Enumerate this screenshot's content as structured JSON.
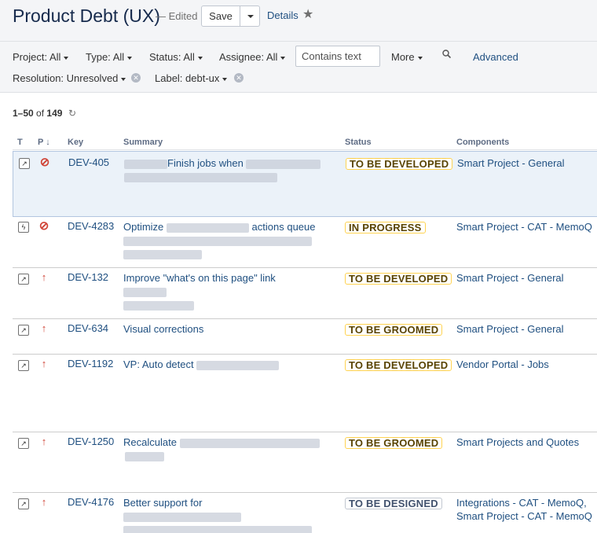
{
  "header": {
    "title": "Product Debt (UX)",
    "edited": "— Edited",
    "save_label": "Save",
    "details_label": "Details"
  },
  "filters": {
    "project": "Project: All",
    "type": "Type: All",
    "status": "Status: All",
    "assignee": "Assignee: All",
    "text_placeholder": "Contains text",
    "more": "More",
    "advanced": "Advanced",
    "resolution": "Resolution: Unresolved",
    "label": "Label: debt-ux"
  },
  "results": {
    "range": "1–50",
    "of": "of",
    "total": "149"
  },
  "columns": {
    "type": "T",
    "priority": "P",
    "key": "Key",
    "summary": "Summary",
    "status": "Status",
    "components": "Components"
  },
  "issues": [
    {
      "type_icon": "story-icon",
      "priority_icon": "blocker-icon",
      "key": "DEV-405",
      "summary": "Finish jobs when",
      "status": "TO BE DEVELOPED",
      "components": [
        "Smart Project - General"
      ]
    },
    {
      "type_icon": "task-icon",
      "priority_icon": "blocker-icon",
      "key": "DEV-4283",
      "summary_a": "Optimize",
      "summary_b": "actions queue",
      "status": "IN PROGRESS",
      "components": [
        "Smart Project - CAT - MemoQ"
      ]
    },
    {
      "type_icon": "story-icon",
      "priority_icon": "major-icon",
      "key": "DEV-132",
      "summary": "Improve \"what's on this page\" link",
      "status": "TO BE DEVELOPED",
      "components": [
        "Smart Project - General"
      ]
    },
    {
      "type_icon": "story-icon",
      "priority_icon": "major-icon",
      "key": "DEV-634",
      "summary": "Visual corrections",
      "status": "TO BE GROOMED",
      "components": [
        "Smart Project - General"
      ]
    },
    {
      "type_icon": "story-icon",
      "priority_icon": "major-icon",
      "key": "DEV-1192",
      "summary": "VP: Auto detect",
      "status": "TO BE DEVELOPED",
      "components": [
        "Vendor Portal - Jobs"
      ]
    },
    {
      "type_icon": "story-icon",
      "priority_icon": "major-icon",
      "key": "DEV-1250",
      "summary": "Recalculate",
      "status": "TO BE GROOMED",
      "components": [
        "Smart Projects and Quotes"
      ]
    },
    {
      "type_icon": "story-icon",
      "priority_icon": "major-icon",
      "key": "DEV-4176",
      "summary": "Better support for",
      "status": "TO BE DESIGNED",
      "components": [
        "Integrations - CAT - MemoQ,",
        "Smart Project - CAT - MemoQ"
      ]
    }
  ]
}
